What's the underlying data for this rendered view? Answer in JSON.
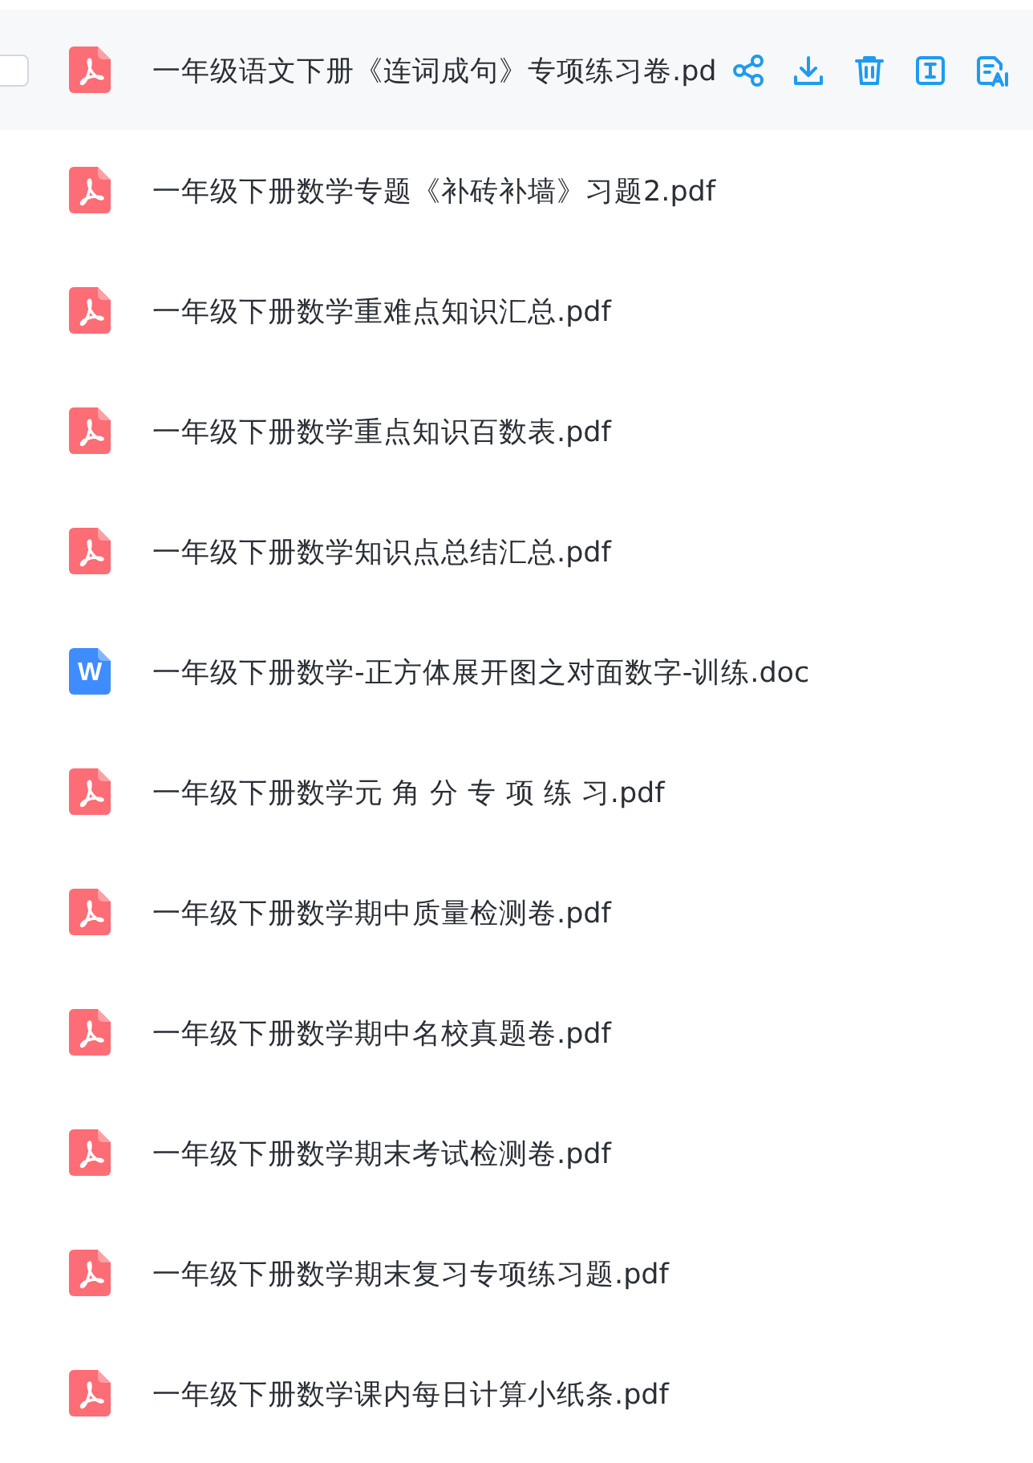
{
  "files": [
    {
      "kind": "pdf",
      "name": "一年级语文下册《连词成句》专项练习卷.pd",
      "hovered": true,
      "checked": false
    },
    {
      "kind": "pdf",
      "name": "一年级下册数学专题《补砖补墙》习题2.pdf",
      "hovered": false
    },
    {
      "kind": "pdf",
      "name": "一年级下册数学重难点知识汇总.pdf",
      "hovered": false
    },
    {
      "kind": "pdf",
      "name": "一年级下册数学重点知识百数表.pdf",
      "hovered": false
    },
    {
      "kind": "pdf",
      "name": "一年级下册数学知识点总结汇总.pdf",
      "hovered": false
    },
    {
      "kind": "doc",
      "badge": "W",
      "name": "一年级下册数学-正方体展开图之对面数字-训练.doc",
      "hovered": false
    },
    {
      "kind": "pdf",
      "name": "一年级下册数学元 角 分 专 项 练 习.pdf",
      "hovered": false
    },
    {
      "kind": "pdf",
      "name": "一年级下册数学期中质量检测卷.pdf",
      "hovered": false
    },
    {
      "kind": "pdf",
      "name": "一年级下册数学期中名校真题卷.pdf",
      "hovered": false
    },
    {
      "kind": "pdf",
      "name": "一年级下册数学期末考试检测卷.pdf",
      "hovered": false
    },
    {
      "kind": "pdf",
      "name": "一年级下册数学期末复习专项练习题.pdf",
      "hovered": false
    },
    {
      "kind": "pdf",
      "name": "一年级下册数学课内每日计算小纸条.pdf",
      "hovered": false
    }
  ]
}
